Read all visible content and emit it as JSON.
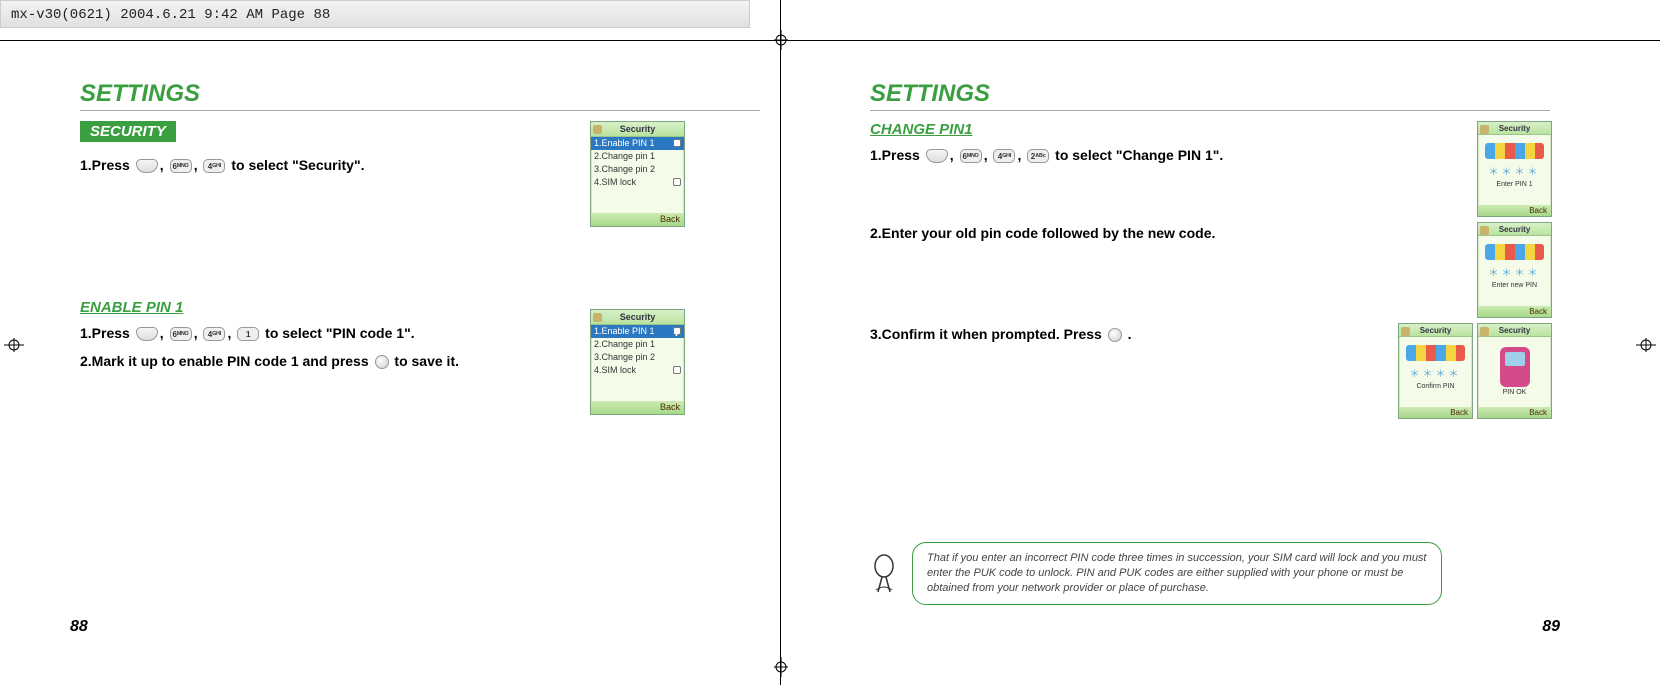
{
  "header": "mx-v30(0621)  2004.6.21  9:42 AM  Page 88",
  "left_page": {
    "title": "SETTINGS",
    "section_label": "SECURITY",
    "step1": {
      "prefix": "1.Press ",
      "keys": [
        "",
        "6ᴹᴺᴼ",
        "4ᴳᴴᴵ"
      ],
      "suffix": " to select \"Security\"."
    },
    "sub1": "ENABLE PIN 1",
    "sub1_step1": {
      "prefix": "1.Press ",
      "keys": [
        "",
        "6ᴹᴺᴼ",
        "4ᴳᴴᴵ",
        "1"
      ],
      "suffix": " to select \"PIN code 1\"."
    },
    "sub1_step2": {
      "prefix": "2.Mark it up to enable PIN code 1 and press ",
      "suffix": " to save it."
    },
    "page_num": "88"
  },
  "right_page": {
    "title": "SETTINGS",
    "sub1": "CHANGE PIN1",
    "sub1_step1": {
      "prefix": "1.Press ",
      "keys": [
        "",
        "6ᴹᴺᴼ",
        "4ᴳᴴᴵ",
        "2ᴬᴮᶜ"
      ],
      "suffix": " to select \"Change PIN 1\"."
    },
    "step2": "2.Enter your old pin code followed by the new code.",
    "step3": {
      "prefix": "3.Confirm it when prompted. Press ",
      "suffix": " ."
    },
    "note": "That if you enter an incorrect PIN code three times in succession, your SIM card will lock and you must enter the PUK code to unlock. PIN and PUK codes are either supplied with your phone or must be obtained from your network provider or place of purchase.",
    "page_num": "89"
  },
  "mock": {
    "security_title": "Security",
    "items": [
      "1.Enable PIN 1",
      "2.Change pin 1",
      "3.Change pin 2",
      "4.SIM lock"
    ],
    "back": "Back",
    "enter_pin1": "Enter PIN 1",
    "enter_new_pin": "Enter new PIN",
    "confirm_pin": "Confirm PIN",
    "pin_ok": "PIN OK"
  }
}
